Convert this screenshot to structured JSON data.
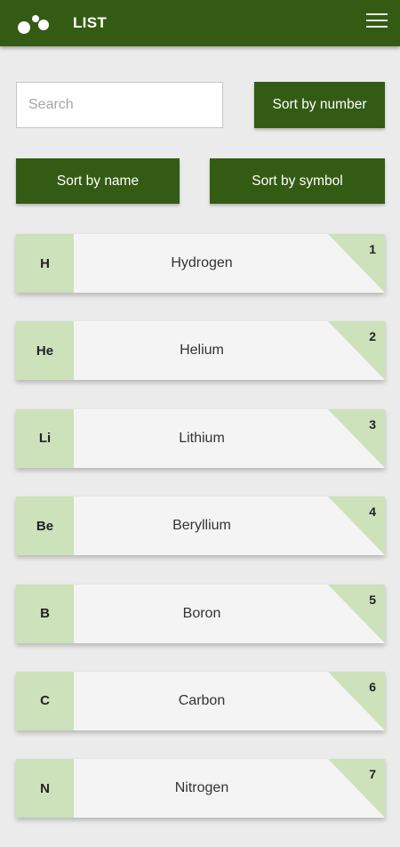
{
  "appbar": {
    "title": "LIST",
    "logo_icon": "molecule-logo-icon",
    "menu_icon": "hamburger-menu-icon",
    "background_color": "#345b14"
  },
  "search": {
    "placeholder": "Search",
    "value": ""
  },
  "sort_buttons": {
    "by_number": "Sort by number",
    "by_name": "Sort by name",
    "by_symbol": "Sort by symbol"
  },
  "colors": {
    "accent": "#345b14",
    "highlight": "#cde1bb",
    "card_bg": "#f4f4f4",
    "page_bg": "#ebebeb"
  },
  "elements": [
    {
      "symbol": "H",
      "name": "Hydrogen",
      "number": "1"
    },
    {
      "symbol": "He",
      "name": "Helium",
      "number": "2"
    },
    {
      "symbol": "Li",
      "name": "Lithium",
      "number": "3"
    },
    {
      "symbol": "Be",
      "name": "Beryllium",
      "number": "4"
    },
    {
      "symbol": "B",
      "name": "Boron",
      "number": "5"
    },
    {
      "symbol": "C",
      "name": "Carbon",
      "number": "6"
    },
    {
      "symbol": "N",
      "name": "Nitrogen",
      "number": "7"
    }
  ]
}
